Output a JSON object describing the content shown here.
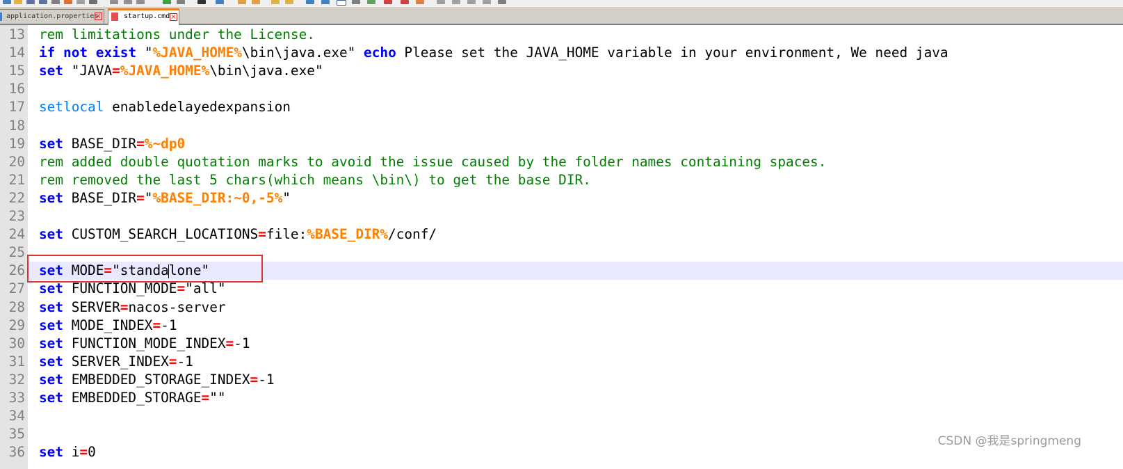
{
  "tabs": [
    {
      "label": "application.properties",
      "active": false
    },
    {
      "label": "startup.cmd",
      "active": true
    }
  ],
  "lines": [
    {
      "num": "13",
      "segments": [
        {
          "t": "rem limitations under the License.",
          "c": "cm"
        }
      ]
    },
    {
      "num": "14",
      "segments": [
        {
          "t": "if",
          "c": "kw"
        },
        {
          "t": " ",
          "c": ""
        },
        {
          "t": "not",
          "c": "kw"
        },
        {
          "t": " ",
          "c": ""
        },
        {
          "t": "exist",
          "c": "kw"
        },
        {
          "t": " \"",
          "c": ""
        },
        {
          "t": "%JAVA_HOME%",
          "c": "var"
        },
        {
          "t": "\\bin\\java.exe\" ",
          "c": ""
        },
        {
          "t": "echo",
          "c": "kw"
        },
        {
          "t": " Please set the JAVA_HOME variable in your environment, We need java",
          "c": ""
        }
      ]
    },
    {
      "num": "15",
      "segments": [
        {
          "t": "set",
          "c": "kw"
        },
        {
          "t": " \"JAVA",
          "c": ""
        },
        {
          "t": "=",
          "c": "op"
        },
        {
          "t": "%JAVA_HOME%",
          "c": "var"
        },
        {
          "t": "\\bin\\java.exe\"",
          "c": ""
        }
      ]
    },
    {
      "num": "16",
      "segments": []
    },
    {
      "num": "17",
      "segments": [
        {
          "t": "setlocal",
          "c": "kw2"
        },
        {
          "t": " enabledelayedexpansion",
          "c": ""
        }
      ]
    },
    {
      "num": "18",
      "segments": []
    },
    {
      "num": "19",
      "segments": [
        {
          "t": "set",
          "c": "kw"
        },
        {
          "t": " BASE_DIR",
          "c": ""
        },
        {
          "t": "=",
          "c": "op"
        },
        {
          "t": "%~dp0",
          "c": "var"
        }
      ]
    },
    {
      "num": "20",
      "segments": [
        {
          "t": "rem added double quotation marks to avoid the issue caused by the folder names containing spaces.",
          "c": "cm"
        }
      ]
    },
    {
      "num": "21",
      "segments": [
        {
          "t": "rem removed the last 5 chars(which means \\bin\\) to get the base DIR.",
          "c": "cm"
        }
      ]
    },
    {
      "num": "22",
      "segments": [
        {
          "t": "set",
          "c": "kw"
        },
        {
          "t": " BASE_DIR",
          "c": ""
        },
        {
          "t": "=",
          "c": "op"
        },
        {
          "t": "\"",
          "c": ""
        },
        {
          "t": "%BASE_DIR:~0,-5%",
          "c": "var"
        },
        {
          "t": "\"",
          "c": ""
        }
      ]
    },
    {
      "num": "23",
      "segments": []
    },
    {
      "num": "24",
      "segments": [
        {
          "t": "set",
          "c": "kw"
        },
        {
          "t": " CUSTOM_SEARCH_LOCATIONS",
          "c": ""
        },
        {
          "t": "=",
          "c": "op"
        },
        {
          "t": "file:",
          "c": ""
        },
        {
          "t": "%BASE_DIR%",
          "c": "var"
        },
        {
          "t": "/conf/",
          "c": ""
        }
      ]
    },
    {
      "num": "25",
      "segments": []
    },
    {
      "num": "26",
      "current": true,
      "segments": [
        {
          "t": "set",
          "c": "kw"
        },
        {
          "t": " MODE",
          "c": ""
        },
        {
          "t": "=",
          "c": "op"
        },
        {
          "t": "\"standa",
          "c": ""
        },
        {
          "t": "",
          "c": "cursor"
        },
        {
          "t": "lone\"",
          "c": ""
        }
      ]
    },
    {
      "num": "27",
      "segments": [
        {
          "t": "set",
          "c": "kw"
        },
        {
          "t": " FUNCTION_MODE",
          "c": ""
        },
        {
          "t": "=",
          "c": "op"
        },
        {
          "t": "\"all\"",
          "c": ""
        }
      ]
    },
    {
      "num": "28",
      "segments": [
        {
          "t": "set",
          "c": "kw"
        },
        {
          "t": " SERVER",
          "c": ""
        },
        {
          "t": "=",
          "c": "op"
        },
        {
          "t": "nacos-server",
          "c": ""
        }
      ]
    },
    {
      "num": "29",
      "segments": [
        {
          "t": "set",
          "c": "kw"
        },
        {
          "t": " MODE_INDEX",
          "c": ""
        },
        {
          "t": "=",
          "c": "op"
        },
        {
          "t": "-1",
          "c": ""
        }
      ]
    },
    {
      "num": "30",
      "segments": [
        {
          "t": "set",
          "c": "kw"
        },
        {
          "t": " FUNCTION_MODE_INDEX",
          "c": ""
        },
        {
          "t": "=",
          "c": "op"
        },
        {
          "t": "-1",
          "c": ""
        }
      ]
    },
    {
      "num": "31",
      "segments": [
        {
          "t": "set",
          "c": "kw"
        },
        {
          "t": " SERVER_INDEX",
          "c": ""
        },
        {
          "t": "=",
          "c": "op"
        },
        {
          "t": "-1",
          "c": ""
        }
      ]
    },
    {
      "num": "32",
      "segments": [
        {
          "t": "set",
          "c": "kw"
        },
        {
          "t": " EMBEDDED_STORAGE_INDEX",
          "c": ""
        },
        {
          "t": "=",
          "c": "op"
        },
        {
          "t": "-1",
          "c": ""
        }
      ]
    },
    {
      "num": "33",
      "segments": [
        {
          "t": "set",
          "c": "kw"
        },
        {
          "t": " EMBEDDED_STORAGE",
          "c": ""
        },
        {
          "t": "=",
          "c": "op"
        },
        {
          "t": "\"\"",
          "c": ""
        }
      ]
    },
    {
      "num": "34",
      "segments": []
    },
    {
      "num": "35",
      "segments": []
    },
    {
      "num": "36",
      "segments": [
        {
          "t": "set",
          "c": "kw"
        },
        {
          "t": " i",
          "c": ""
        },
        {
          "t": "=",
          "c": "op"
        },
        {
          "t": "0",
          "c": ""
        }
      ]
    }
  ],
  "watermark": "CSDN @我是springmeng",
  "colors": {
    "keyword": "#0000ff",
    "comment": "#008000",
    "operator": "#ff0000",
    "variable": "#ff8000",
    "highlight_box": "#e03030"
  }
}
